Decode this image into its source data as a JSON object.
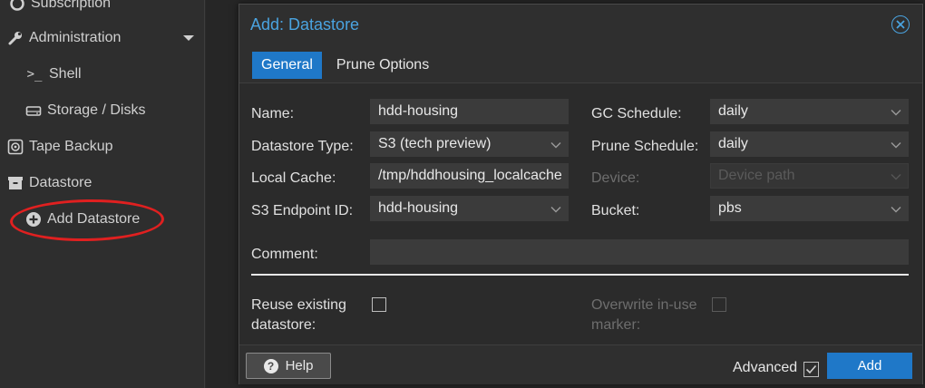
{
  "sidebar": {
    "items": [
      {
        "label": "Subscription",
        "icon": "lifebuoy-icon"
      },
      {
        "label": "Administration",
        "icon": "wrench-icon"
      },
      {
        "label": "Shell",
        "icon": "terminal-icon"
      },
      {
        "label": "Storage / Disks",
        "icon": "hdd-icon"
      },
      {
        "label": "Tape Backup",
        "icon": "tape-icon"
      },
      {
        "label": "Datastore",
        "icon": "archive-icon"
      },
      {
        "label": "Add Datastore",
        "icon": "plus-circle-icon"
      }
    ],
    "highlight_color": "#e02020"
  },
  "dialog": {
    "title": "Add: Datastore",
    "tabs": [
      {
        "label": "General",
        "active": true
      },
      {
        "label": "Prune Options",
        "active": false
      }
    ],
    "left": {
      "name_label": "Name:",
      "name_value": "hdd-housing",
      "type_label": "Datastore Type:",
      "type_value": "S3 (tech preview)",
      "cache_label": "Local Cache:",
      "cache_value": "/tmp/hddhousing_localcache",
      "endpoint_label": "S3 Endpoint ID:",
      "endpoint_value": "hdd-housing"
    },
    "right": {
      "gc_label": "GC Schedule:",
      "gc_value": "daily",
      "prune_label": "Prune Schedule:",
      "prune_value": "daily",
      "device_label": "Device:",
      "device_placeholder": "Device path",
      "bucket_label": "Bucket:",
      "bucket_value": "pbs"
    },
    "comment_label": "Comment:",
    "comment_value": "",
    "reuse_label_1": "Reuse existing",
    "reuse_label_2": "datastore:",
    "overwrite_label_1": "Overwrite in-use",
    "overwrite_label_2": "marker:",
    "footer": {
      "help_label": "Help",
      "advanced_label": "Advanced",
      "advanced_checked": true,
      "add_label": "Add"
    },
    "accent_color": "#1f78c8",
    "title_color": "#4aa3e0"
  }
}
